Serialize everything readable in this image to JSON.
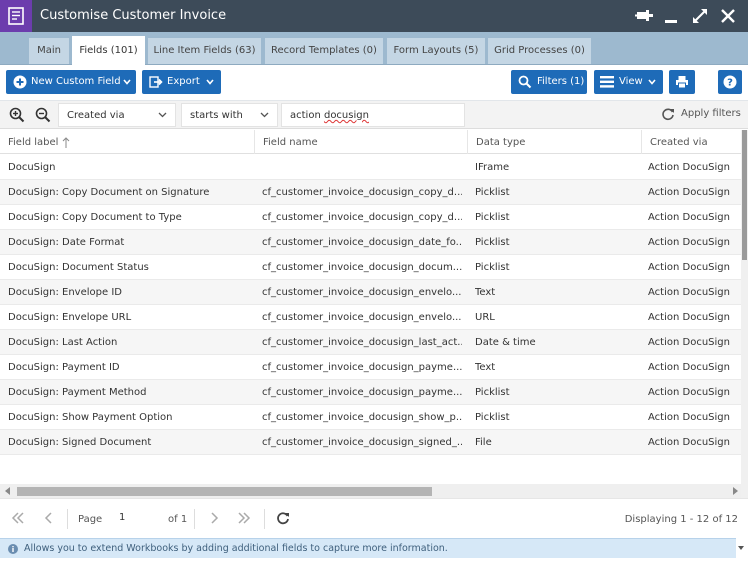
{
  "window": {
    "title": "Customise Customer Invoice",
    "icon": "document-icon"
  },
  "tabs": [
    {
      "label": "Main",
      "active": false
    },
    {
      "label": "Fields (101)",
      "active": true
    },
    {
      "label": "Line Item Fields (63)",
      "active": false
    },
    {
      "label": "Record Templates (0)",
      "active": false
    },
    {
      "label": "Form Layouts (5)",
      "active": false
    },
    {
      "label": "Grid Processes (0)",
      "active": false
    }
  ],
  "toolbar": {
    "new_custom_field": "New Custom Field",
    "export": "Export",
    "filters": "Filters (1)",
    "view": "View"
  },
  "filter": {
    "field": "Created via",
    "operator": "starts with",
    "value_prefix": "action ",
    "value_word": "docusign",
    "apply": "Apply filters"
  },
  "columns": [
    "Field label",
    "Field name",
    "Data type",
    "Created via"
  ],
  "rows": [
    [
      "DocuSign",
      "",
      "IFrame",
      "Action DocuSign"
    ],
    [
      "DocuSign: Copy Document on Signature",
      "cf_customer_invoice_docusign_copy_d...",
      "Picklist",
      "Action DocuSign"
    ],
    [
      "DocuSign: Copy Document to Type",
      "cf_customer_invoice_docusign_copy_d...",
      "Picklist",
      "Action DocuSign"
    ],
    [
      "DocuSign: Date Format",
      "cf_customer_invoice_docusign_date_fo...",
      "Picklist",
      "Action DocuSign"
    ],
    [
      "DocuSign: Document Status",
      "cf_customer_invoice_docusign_docum...",
      "Picklist",
      "Action DocuSign"
    ],
    [
      "DocuSign: Envelope ID",
      "cf_customer_invoice_docusign_envelo...",
      "Text",
      "Action DocuSign"
    ],
    [
      "DocuSign: Envelope URL",
      "cf_customer_invoice_docusign_envelo...",
      "URL",
      "Action DocuSign"
    ],
    [
      "DocuSign: Last Action",
      "cf_customer_invoice_docusign_last_act...",
      "Date & time",
      "Action DocuSign"
    ],
    [
      "DocuSign: Payment ID",
      "cf_customer_invoice_docusign_payme...",
      "Text",
      "Action DocuSign"
    ],
    [
      "DocuSign: Payment Method",
      "cf_customer_invoice_docusign_payme...",
      "Picklist",
      "Action DocuSign"
    ],
    [
      "DocuSign: Show Payment Option",
      "cf_customer_invoice_docusign_show_p...",
      "Picklist",
      "Action DocuSign"
    ],
    [
      "DocuSign: Signed Document",
      "cf_customer_invoice_docusign_signed_...",
      "File",
      "Action DocuSign"
    ]
  ],
  "pager": {
    "page_label": "Page",
    "page_value": "1",
    "of_label": "of 1",
    "displaying": "Displaying 1 - 12 of 12"
  },
  "info": "Allows you to extend Workbooks by adding additional fields to capture more information.",
  "colors": {
    "titlebar": "#3d4b59",
    "app_icon": "#6c3dad",
    "tabstrip": "#9db9cf",
    "button": "#1e6bb8",
    "info_bar": "#d6e8f7"
  }
}
